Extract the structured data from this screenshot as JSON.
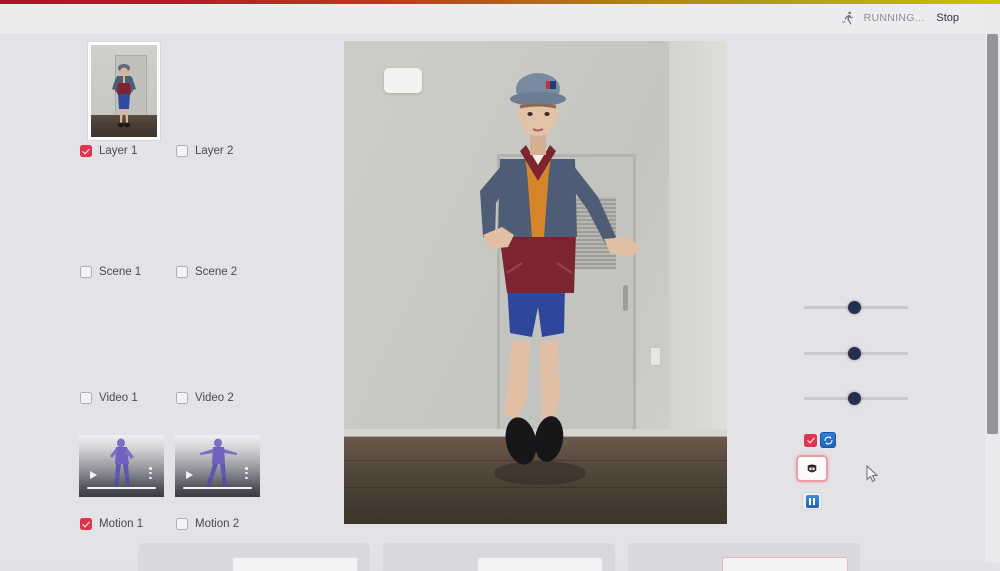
{
  "window": {
    "background_color": "#e2e1e6",
    "accent_color": "#e0334c",
    "stripe_colors": [
      "#b01025",
      "#c7c400"
    ]
  },
  "header": {
    "running_icon": "running-person-icon",
    "status_text": "RUNNING...",
    "stop_label": "Stop"
  },
  "left_panel": {
    "reference_thumbnail": {
      "name": "reference-frame-thumbnail"
    },
    "groups": [
      {
        "id": "layers",
        "items": [
          {
            "label": "Layer 1",
            "checked": true
          },
          {
            "label": "Layer 2",
            "checked": false
          }
        ]
      },
      {
        "id": "scenes",
        "items": [
          {
            "label": "Scene 1",
            "checked": false
          },
          {
            "label": "Scene 2",
            "checked": false
          }
        ]
      },
      {
        "id": "videos",
        "items": [
          {
            "label": "Video 1",
            "checked": false
          },
          {
            "label": "Video 2",
            "checked": false
          }
        ]
      },
      {
        "id": "motions",
        "items": [
          {
            "label": "Motion 1",
            "checked": true
          },
          {
            "label": "Motion 2",
            "checked": false
          }
        ]
      }
    ],
    "motion_previews": [
      {
        "name": "motion-preview-1",
        "play_icon": "play-icon",
        "menu_icon": "kebab-menu-icon",
        "progress": 100
      },
      {
        "name": "motion-preview-2",
        "play_icon": "play-icon",
        "menu_icon": "kebab-menu-icon",
        "progress": 100
      }
    ]
  },
  "video_stage": {
    "name": "main-video-preview",
    "description": "Person in blue bucket hat, blue and maroon fleece pullover and blue shorts dancing in front of a louvered door on dark wood flooring"
  },
  "right_panel": {
    "sliders": [
      {
        "name": "slider-1",
        "value": 50
      },
      {
        "name": "slider-2",
        "value": 50
      },
      {
        "name": "slider-3",
        "value": 50
      }
    ],
    "buttons": [
      {
        "name": "enable-checkbox",
        "icon": "check-icon",
        "state": "on"
      },
      {
        "name": "sync-button",
        "icon": "sync-refresh-icon",
        "state": "normal"
      },
      {
        "name": "avatar-button",
        "icon": "avatar-head-icon",
        "state": "selected"
      },
      {
        "name": "pause-button",
        "icon": "pause-icon",
        "state": "normal"
      }
    ]
  },
  "bottom_cards": [
    {
      "name": "settings-card-1",
      "label": "",
      "field_accent": false
    },
    {
      "name": "settings-card-2",
      "label": "",
      "field_accent": false
    },
    {
      "name": "settings-card-3",
      "label": "",
      "field_accent": true
    }
  ],
  "scrollbar": {
    "name": "vertical-scrollbar",
    "position": 0
  }
}
